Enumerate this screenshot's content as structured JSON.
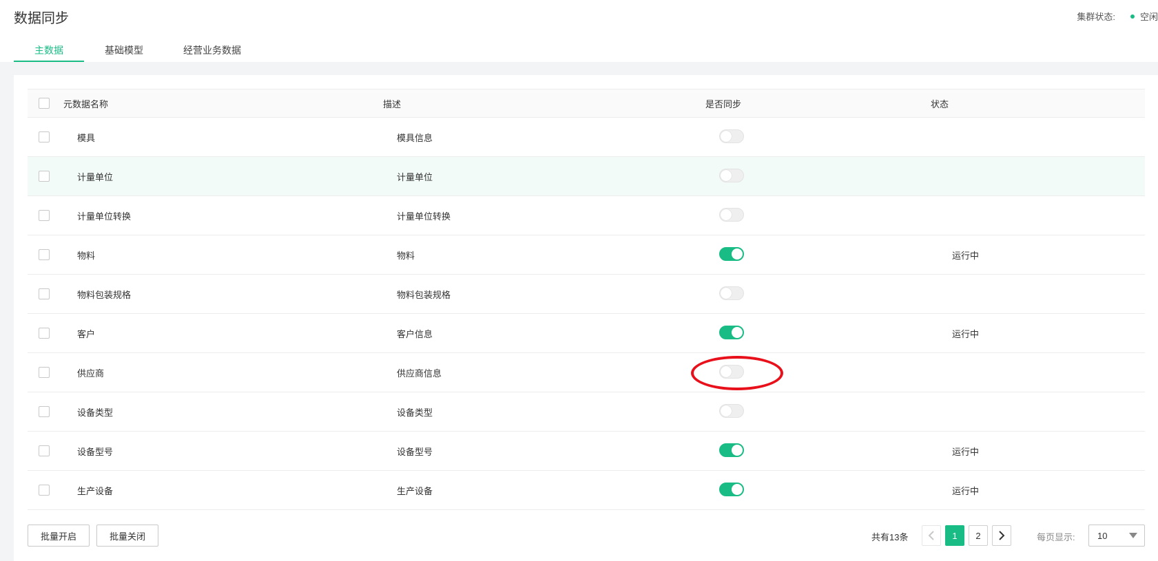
{
  "header": {
    "title": "数据同步",
    "cluster_label": "集群状态:",
    "cluster_status": "空闲",
    "cluster_status_color": "#1abc86"
  },
  "tabs": [
    {
      "label": "主数据",
      "active": true
    },
    {
      "label": "基础模型",
      "active": false
    },
    {
      "label": "经营业务数据",
      "active": false
    }
  ],
  "table": {
    "columns": [
      "元数据名称",
      "描述",
      "是否同步",
      "状态"
    ],
    "rows": [
      {
        "name": "模具",
        "desc": "模具信息",
        "sync": false,
        "status": ""
      },
      {
        "name": "计量单位",
        "desc": "计量单位",
        "sync": false,
        "status": ""
      },
      {
        "name": "计量单位转换",
        "desc": "计量单位转换",
        "sync": false,
        "status": ""
      },
      {
        "name": "物料",
        "desc": "物料",
        "sync": true,
        "status": "运行中"
      },
      {
        "name": "物料包装规格",
        "desc": "物料包装规格",
        "sync": false,
        "status": ""
      },
      {
        "name": "客户",
        "desc": "客户信息",
        "sync": true,
        "status": "运行中"
      },
      {
        "name": "供应商",
        "desc": "供应商信息",
        "sync": false,
        "status": ""
      },
      {
        "name": "设备类型",
        "desc": "设备类型",
        "sync": false,
        "status": ""
      },
      {
        "name": "设备型号",
        "desc": "设备型号",
        "sync": true,
        "status": "运行中"
      },
      {
        "name": "生产设备",
        "desc": "生产设备",
        "sync": true,
        "status": "运行中"
      }
    ]
  },
  "footer": {
    "batch_open": "批量开启",
    "batch_close": "批量关闭",
    "total": "共有13条",
    "pages": [
      "1",
      "2"
    ],
    "current_page": "1",
    "per_page_label": "每页显示:",
    "per_page_value": "10"
  },
  "colors": {
    "accent": "#1abc86",
    "annotation": "#e8101a"
  }
}
